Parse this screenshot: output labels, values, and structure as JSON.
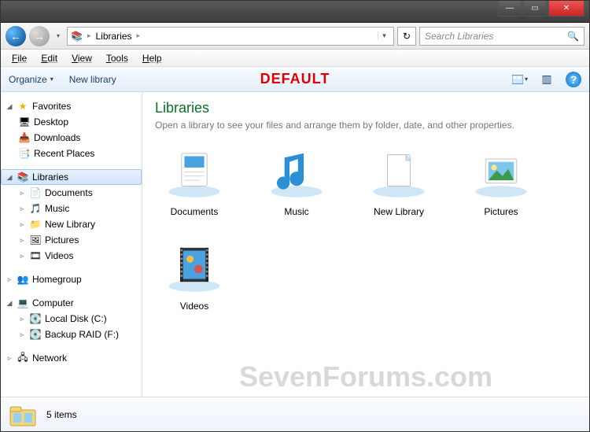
{
  "titlebar": {
    "min": "—",
    "max": "▭",
    "close": "✕"
  },
  "nav": {
    "back": "←",
    "fwd": "→",
    "hist": "▾",
    "crumbs": [
      "Libraries"
    ],
    "sep": "▸",
    "dropdown": "▾",
    "refresh": "↻",
    "search_placeholder": "Search Libraries",
    "search_icon": "🔍"
  },
  "menu": [
    "File",
    "Edit",
    "View",
    "Tools",
    "Help"
  ],
  "toolbar": {
    "organize": "Organize",
    "organize_dd": "▾",
    "newlib": "New library",
    "overlay": "DEFAULT",
    "view_dd": "▾",
    "pane": "▥",
    "help": "?"
  },
  "sidebar": {
    "favorites": {
      "label": "Favorites",
      "arrow": "◢",
      "star": "★",
      "items": [
        {
          "label": "Desktop",
          "icon": "🖥"
        },
        {
          "label": "Downloads",
          "icon": "📥"
        },
        {
          "label": "Recent Places",
          "icon": "📑"
        }
      ]
    },
    "libraries": {
      "label": "Libraries",
      "arrow": "◢",
      "icon": "📚",
      "items": [
        {
          "label": "Documents",
          "icon": "📄",
          "arrow": "▹"
        },
        {
          "label": "Music",
          "icon": "🎵",
          "arrow": "▹"
        },
        {
          "label": "New Library",
          "icon": "📁",
          "arrow": "▹"
        },
        {
          "label": "Pictures",
          "icon": "🖼",
          "arrow": "▹"
        },
        {
          "label": "Videos",
          "icon": "🎞",
          "arrow": "▹"
        }
      ]
    },
    "homegroup": {
      "label": "Homegroup",
      "arrow": "▹",
      "icon": "👥"
    },
    "computer": {
      "label": "Computer",
      "arrow": "◢",
      "icon": "💻",
      "items": [
        {
          "label": "Local Disk (C:)",
          "icon": "💽",
          "arrow": "▹"
        },
        {
          "label": "Backup RAID (F:)",
          "icon": "💽",
          "arrow": "▹"
        }
      ]
    },
    "network": {
      "label": "Network",
      "arrow": "▹",
      "icon": "🖧"
    }
  },
  "content": {
    "heading": "Libraries",
    "subhead": "Open a library to see your files and arrange them by folder, date, and other properties.",
    "items": [
      {
        "label": "Documents"
      },
      {
        "label": "Music"
      },
      {
        "label": "New Library"
      },
      {
        "label": "Pictures"
      },
      {
        "label": "Videos"
      }
    ],
    "watermark": "SevenForums.com"
  },
  "status": {
    "count": "5 items"
  }
}
